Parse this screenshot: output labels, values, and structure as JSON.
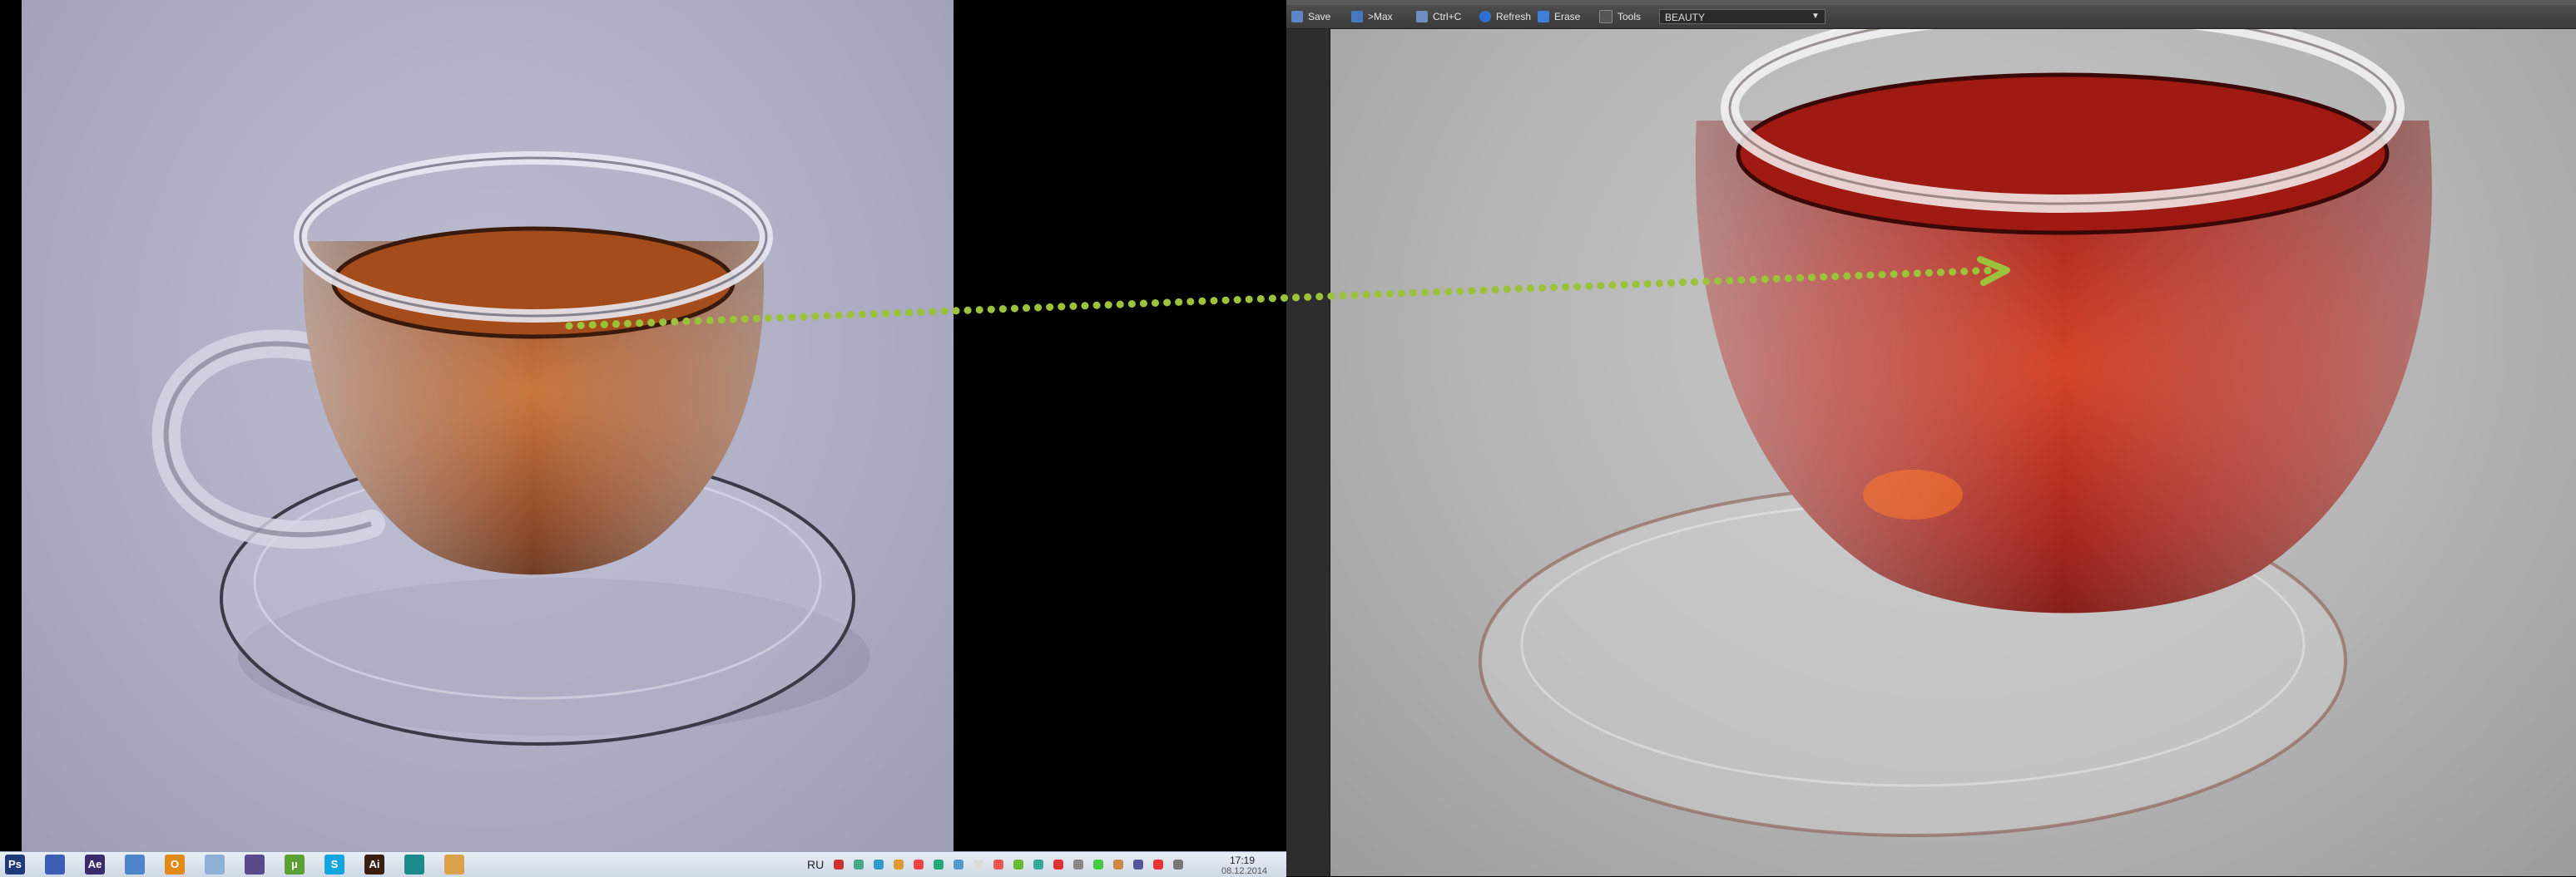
{
  "taskbar": {
    "language": "RU",
    "clock_time": "17:19",
    "clock_date": "08.12.2014",
    "apps": [
      {
        "label": "Ps",
        "name": "photoshop-icon",
        "color": "#1e3a78"
      },
      {
        "label": "",
        "name": "save-disk-icon",
        "color": "#3a5fb5"
      },
      {
        "label": "Ae",
        "name": "after-effects-icon",
        "color": "#3a2b6b"
      },
      {
        "label": "",
        "name": "explorer-icon",
        "color": "#4c86c8"
      },
      {
        "label": "O",
        "name": "outlook-icon",
        "color": "#e08a1a"
      },
      {
        "label": "",
        "name": "image-viewer-icon",
        "color": "#8fb0d6"
      },
      {
        "label": "",
        "name": "visual-studio-icon",
        "color": "#5a4a8c"
      },
      {
        "label": "µ",
        "name": "utorrent-icon",
        "color": "#5aa032"
      },
      {
        "label": "S",
        "name": "skype-icon",
        "color": "#12a5e0"
      },
      {
        "label": "Ai",
        "name": "illustrator-icon",
        "color": "#3a1e10"
      },
      {
        "label": "",
        "name": "3dsmax-icon",
        "color": "#1a8a8a"
      },
      {
        "label": "",
        "name": "teapot-app-icon",
        "color": "#d9a24a"
      }
    ]
  },
  "renderer": {
    "toolbar": {
      "save": "Save",
      "max": ">Max",
      "copy": "Ctrl+C",
      "refresh": "Refresh",
      "erase": "Erase",
      "tools": "Tools",
      "render_pass": "BEAUTY"
    }
  },
  "colors": {
    "annotation_arrow": "#9bc23a",
    "left_background": "#b0b0c6",
    "right_background": "#bdbdbd",
    "tea_left": "#a8511e",
    "tea_right": "#b32418"
  }
}
